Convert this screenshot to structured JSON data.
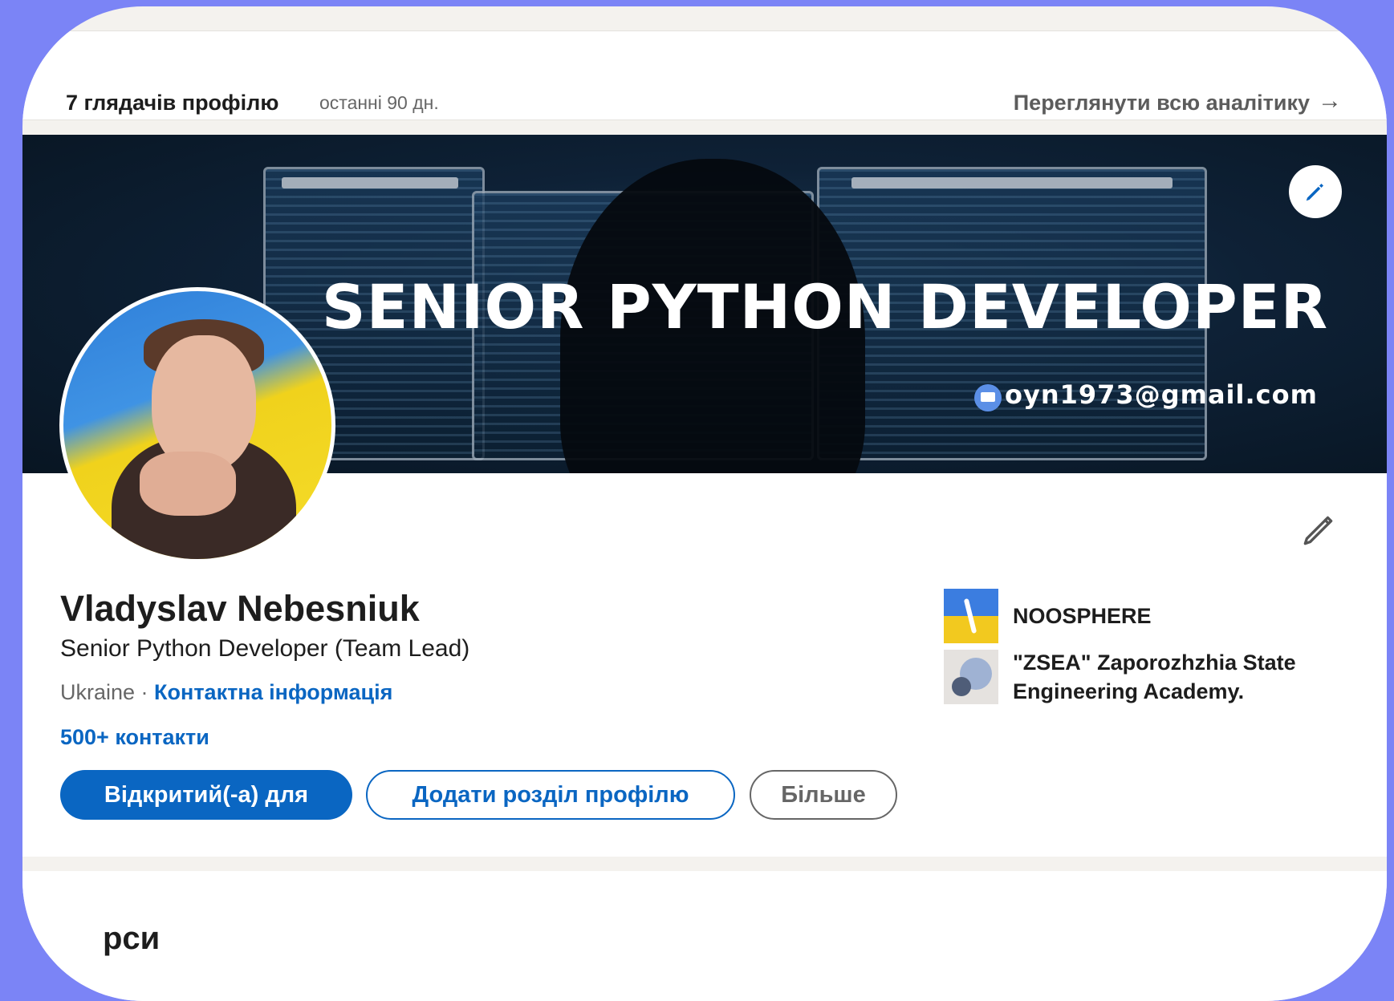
{
  "analytics": {
    "views_label": "7 глядачів профілю",
    "period": "останні 90 дн.",
    "view_all": "Переглянути всю аналітику",
    "arrow": "→"
  },
  "banner": {
    "title": "SENIOR PYTHON DEVELOPER",
    "email": "oyn1973@gmail.com"
  },
  "profile": {
    "name": "Vladyslav Nebesniuk",
    "headline": "Senior Python Developer (Team Lead)",
    "location": "Ukraine",
    "separator": " · ",
    "contact_info": "Контактна інформація",
    "connections": "500+ контакти"
  },
  "buttons": {
    "open_to": "Відкритий(-а) для",
    "add_section": "Додати розділ профілю",
    "more": "Більше"
  },
  "organizations": [
    {
      "name": "NOOSPHERE"
    },
    {
      "name": "\"ZSEA\" Zaporozhzhia State Engineering Academy."
    }
  ],
  "next_section": {
    "title": "рси"
  },
  "colors": {
    "accent": "#0a66c2",
    "background": "#7b84f6",
    "page": "#f4f2ee"
  },
  "icons": {
    "banner_edit": "pencil-icon",
    "card_edit": "pencil-outline-icon",
    "email": "mail-icon",
    "arrow": "arrow-right-icon"
  }
}
